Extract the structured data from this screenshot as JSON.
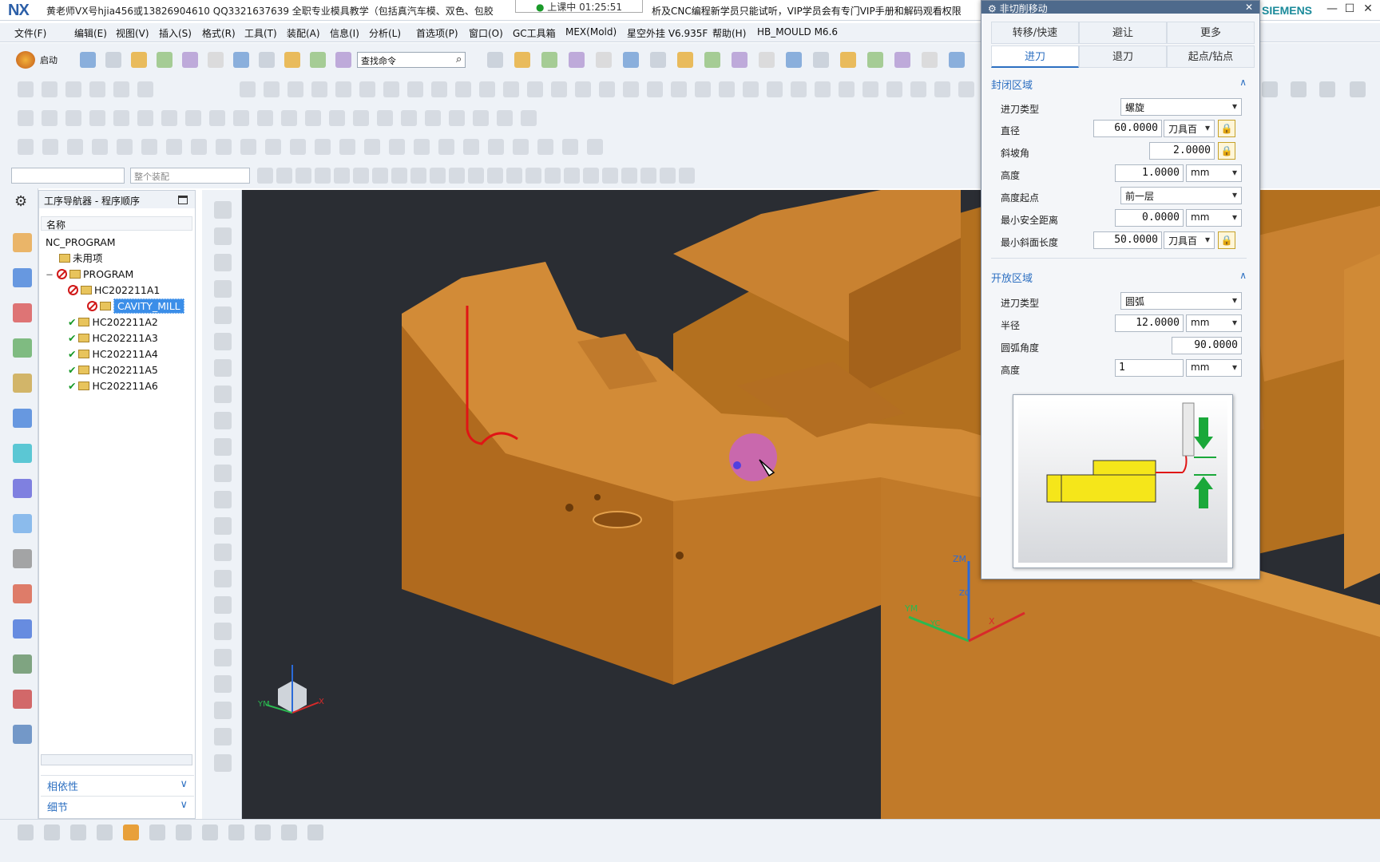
{
  "window": {
    "title": "黄老师VX号hjia456或13826904610 QQ3321637639 全职专业模具教学（包括真汽车模、双色、包胶",
    "title_tail": "析及CNC编程新学员只能试听，VIP学员会有专门VIP手册和解码观看权限",
    "logo": "NX",
    "brand": "SIEMENS",
    "timer": "上课中 01:25:51"
  },
  "menu": [
    "文件(F)",
    "编辑(E)",
    "视图(V)",
    "插入(S)",
    "格式(R)",
    "工具(T)",
    "装配(A)",
    "信息(I)",
    "分析(L)",
    "首选项(P)",
    "窗口(O)",
    "GC工具箱",
    "MEX(Mold)",
    "星空外挂 V6.935F",
    "帮助(H)",
    "HB_MOULD M6.6"
  ],
  "toolbar": {
    "start_label": "启动",
    "find_placeholder": "查找命令",
    "assembly_combo": "整个装配"
  },
  "navigator": {
    "title": "工序导航器 - 程序顺序",
    "column": "名称",
    "root": "NC_PROGRAM",
    "unused": "未用项",
    "program": "PROGRAM",
    "items": [
      {
        "label": "HC202211A1",
        "status": "forbid"
      },
      {
        "label": "CAVITY_MILL",
        "status": "forbid",
        "selected": true
      },
      {
        "label": "HC202211A2",
        "status": "check"
      },
      {
        "label": "HC202211A3",
        "status": "check"
      },
      {
        "label": "HC202211A4",
        "status": "check"
      },
      {
        "label": "HC202211A5",
        "status": "check"
      },
      {
        "label": "HC202211A6",
        "status": "check"
      }
    ],
    "dependency": "相依性",
    "details": "细节"
  },
  "dialog": {
    "title": "非切削移动",
    "tabs_top": [
      "转移/快速",
      "避让",
      "更多"
    ],
    "tabs_bottom": [
      "进刀",
      "退刀",
      "起点/钻点"
    ],
    "closed_section": "封闭区域",
    "closed": {
      "engage_type_label": "进刀类型",
      "engage_type": "螺旋",
      "diameter_label": "直径",
      "diameter": "60.0000",
      "diameter_unit": "刀具百",
      "ramp_label": "斜坡角",
      "ramp": "2.0000",
      "height_label": "高度",
      "height": "1.0000",
      "height_unit": "mm",
      "height_from_label": "高度起点",
      "height_from": "前一层",
      "min_safe_label": "最小安全距离",
      "min_safe": "0.0000",
      "min_safe_unit": "mm",
      "min_ramp_label": "最小斜面长度",
      "min_ramp": "50.0000",
      "min_ramp_unit": "刀具百"
    },
    "open_section": "开放区域",
    "open": {
      "engage_type_label": "进刀类型",
      "engage_type": "圆弧",
      "radius_label": "半径",
      "radius": "12.0000",
      "radius_unit": "mm",
      "arc_angle_label": "圆弧角度",
      "arc_angle": "90.0000",
      "height_label": "高度",
      "height": "1",
      "height_unit": "mm"
    }
  },
  "viewport": {
    "axes": {
      "zm": "ZM",
      "zc": "ZC",
      "ym": "YM",
      "yc": "YC",
      "x": "X"
    }
  },
  "colors": {
    "part": "#c77d2c",
    "background": "#2a2d33",
    "accent": "#2c6fc1",
    "path": "#e01515"
  }
}
